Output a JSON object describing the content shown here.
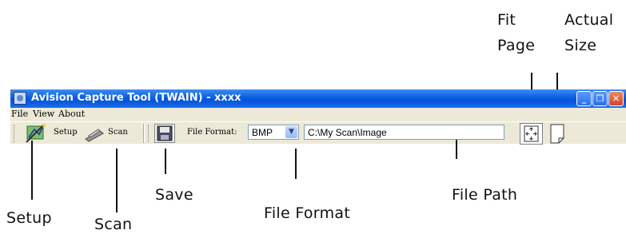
{
  "window": {
    "title": "Avision Capture Tool (TWAIN) -  xxxx",
    "controls": {
      "minimize": "_",
      "restore": "❐",
      "close": "✕"
    }
  },
  "menu": [
    "File",
    "View",
    "About"
  ],
  "toolbar": {
    "setup_label": "Setup",
    "scan_label": "Scan",
    "file_format_label": "File Format:",
    "file_format_value": "BMP",
    "file_path_value": "C:\\My Scan\\Image"
  },
  "callouts": {
    "fit_page_line1": "Fit",
    "fit_page_line2": "Page",
    "actual_size_line1": "Actual",
    "actual_size_line2": "Size",
    "setup": "Setup",
    "scan": "Scan",
    "save": "Save",
    "file_format": "File Format",
    "file_path": "File Path"
  },
  "colors": {
    "titlebar": "#0a5ee0",
    "window_bg": "#ece9d8",
    "close_button": "#d0452a"
  },
  "icons": [
    "setup-wizard-icon",
    "scanner-icon",
    "floppy-save-icon",
    "fit-page-icon",
    "actual-size-icon"
  ]
}
